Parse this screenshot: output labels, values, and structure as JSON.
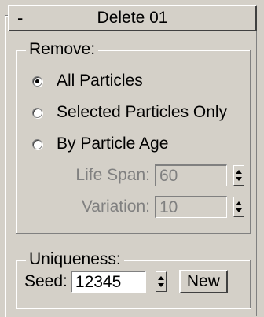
{
  "rollout": {
    "collapse_symbol": "-",
    "title": "Delete 01"
  },
  "remove": {
    "label": "Remove:",
    "options": [
      {
        "label": "All Particles",
        "checked": true
      },
      {
        "label": "Selected Particles Only",
        "checked": false
      },
      {
        "label": "By Particle Age",
        "checked": false
      }
    ],
    "life_span": {
      "label": "Life Span:",
      "value": "60",
      "enabled": false
    },
    "variation": {
      "label": "Variation:",
      "value": "10",
      "enabled": false
    }
  },
  "uniqueness": {
    "label": "Uniqueness:",
    "seed": {
      "label": "Seed:",
      "value": "12345"
    },
    "new_button": "New"
  }
}
